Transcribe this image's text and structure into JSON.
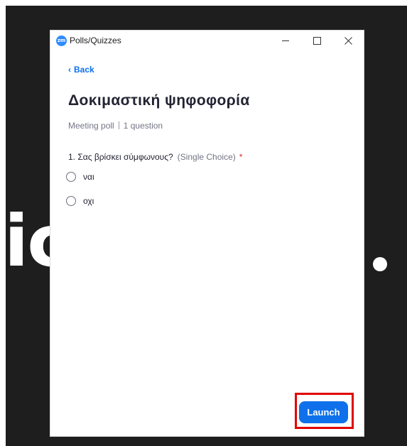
{
  "background": {
    "share_text": "ic",
    "accent_dot": "white-dot"
  },
  "window": {
    "title": "Polls/Quizzes",
    "logo_text": "zm",
    "logo_color": "#2d8cff",
    "controls": {
      "minimize_icon": "minimize-icon",
      "maximize_icon": "maximize-icon",
      "close_icon": "close-icon",
      "close_glyph": "✕"
    }
  },
  "content": {
    "back_label": "Back",
    "back_chevron": "‹",
    "poll_title": "Δοκιμαστική ψηφοφορία",
    "poll_type": "Meeting poll",
    "question_count": "1 question",
    "question": {
      "text": "1. Σας βρίσκει σύμφωνους?",
      "type": "(Single Choice)",
      "required_mark": "*",
      "options": [
        {
          "label": "ναι",
          "selected": false
        },
        {
          "label": "οχι",
          "selected": false
        }
      ]
    },
    "launch_label": "Launch"
  },
  "colors": {
    "accent": "#0e71eb",
    "highlight": "#e00000",
    "required": "#e02828"
  }
}
